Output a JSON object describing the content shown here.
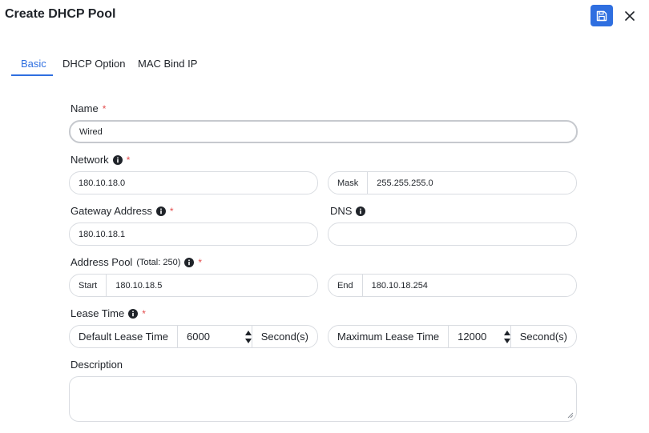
{
  "dialog": {
    "title": "Create DHCP Pool"
  },
  "colors": {
    "accent": "#2f6fe0",
    "required": "#e34d4d",
    "border": "#d9dce1"
  },
  "icons": {
    "save": "floppy-disk-icon",
    "close": "close-icon",
    "info": "info-circle-icon"
  },
  "tabs": [
    {
      "label": "Basic",
      "active": true
    },
    {
      "label": "DHCP Option",
      "active": false
    },
    {
      "label": "MAC Bind IP",
      "active": false
    }
  ],
  "form": {
    "name": {
      "label": "Name",
      "required_mark": "*",
      "value": "Wired"
    },
    "network": {
      "label": "Network",
      "required_mark": "*",
      "value": "180.10.18.0",
      "mask_label": "Mask",
      "mask_value": "255.255.255.0"
    },
    "gateway": {
      "label": "Gateway Address",
      "required_mark": "*",
      "value": "180.10.18.1"
    },
    "dns": {
      "label": "DNS",
      "value": ""
    },
    "address_pool": {
      "label": "Address Pool",
      "total_note": "(Total: 250)",
      "required_mark": "*",
      "start_label": "Start",
      "start_value": "180.10.18.5",
      "end_label": "End",
      "end_value": "180.10.18.254"
    },
    "lease_time": {
      "label": "Lease Time",
      "required_mark": "*",
      "default_label": "Default Lease Time",
      "default_value": "6000",
      "default_unit": "Second(s)",
      "max_label": "Maximum Lease Time",
      "max_value": "12000",
      "max_unit": "Second(s)"
    },
    "description": {
      "label": "Description",
      "value": ""
    }
  }
}
